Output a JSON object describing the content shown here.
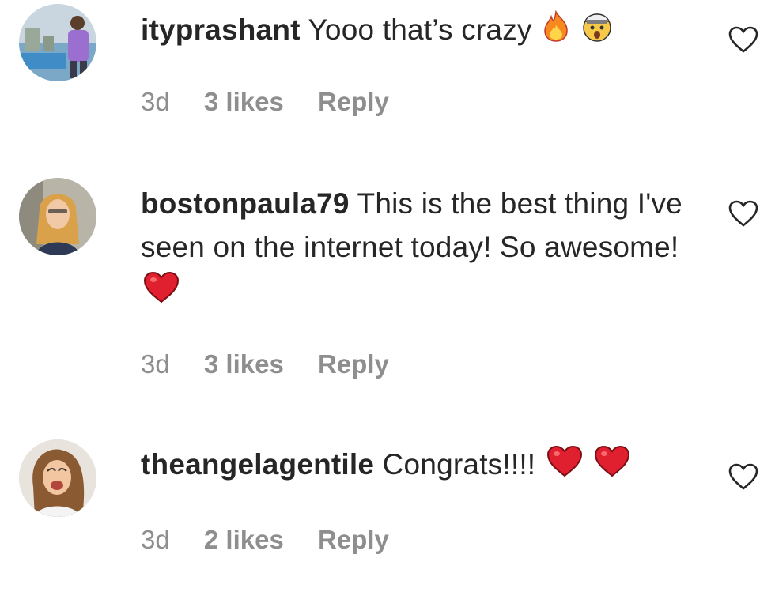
{
  "comments": [
    {
      "username": "ityprashant",
      "text": "Yooo that’s crazy",
      "emojis": [
        "fire-emoji",
        "exploding-head-emoji"
      ],
      "time": "3d",
      "likes": "3 likes",
      "reply": "Reply"
    },
    {
      "username": "bostonpaula79",
      "text": "This is the best thing I've seen on the internet today! So awesome!",
      "emojis": [
        "red-heart-emoji"
      ],
      "time": "3d",
      "likes": "3 likes",
      "reply": "Reply"
    },
    {
      "username": "theangelagentile",
      "text": "Congrats!!!!",
      "emojis": [
        "red-heart-emoji",
        "red-heart-emoji"
      ],
      "time": "3d",
      "likes": "2 likes",
      "reply": "Reply"
    }
  ],
  "colors": {
    "text": "#262626",
    "meta": "#8e8e8e",
    "heart_outline": "#262626",
    "emoji_heart": "#e0202e"
  }
}
